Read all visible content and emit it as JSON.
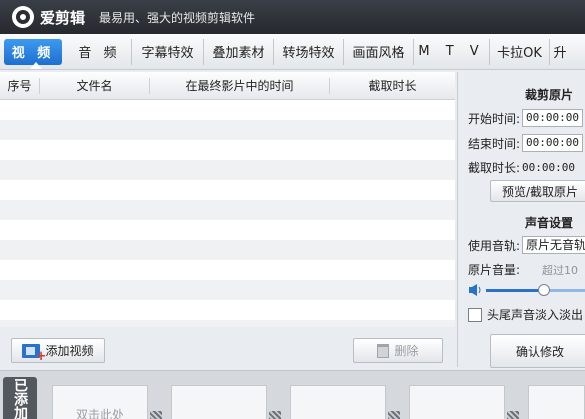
{
  "app": {
    "name": "爱剪辑",
    "slogan": "最易用、强大的视频剪辑软件"
  },
  "tabs": [
    {
      "label": "视 频"
    },
    {
      "label": "音 频"
    },
    {
      "label": "字幕特效"
    },
    {
      "label": "叠加素材"
    },
    {
      "label": "转场特效"
    },
    {
      "label": "画面风格"
    },
    {
      "label": "M T V"
    },
    {
      "label": "卡拉OK"
    },
    {
      "label": "升"
    }
  ],
  "file_table": {
    "columns": [
      "序号",
      "文件名",
      "在最终影片中的时间",
      "截取时长"
    ],
    "rows": []
  },
  "buttons": {
    "add_video": "添加视频",
    "delete": "删除"
  },
  "trim_panel": {
    "title": "裁剪原片",
    "start_label": "开始时间:",
    "start_value": "00:00:00",
    "end_label": "结束时间:",
    "end_value": "00:00:00",
    "duration_label": "截取时长:",
    "duration_value": "00:00:00",
    "preview_button": "预览/截取原片"
  },
  "audio_panel": {
    "title": "声音设置",
    "track_label": "使用音轨:",
    "track_value": "原片无音轨",
    "volume_label": "原片音量:",
    "volume_hint": "超过10",
    "volume_fraction": 0.58,
    "fade_label": "头尾声音淡入淡出",
    "fade_checked": false,
    "confirm_button": "确认修改"
  },
  "storyboard": {
    "side_label": "已添加",
    "slot_hint": "双击此处"
  }
}
